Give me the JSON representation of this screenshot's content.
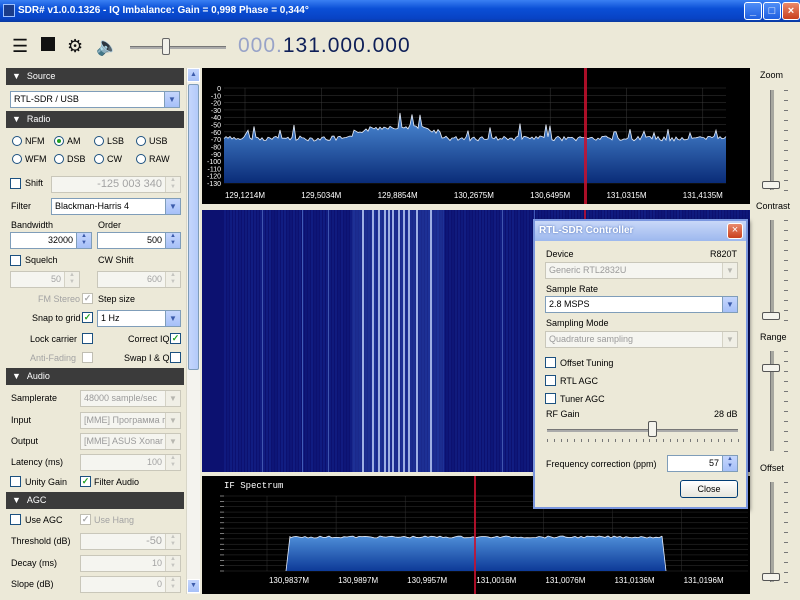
{
  "window": {
    "title": "SDR# v1.0.0.1326 - IQ Imbalance: Gain = 0,998 Phase = 0,344°"
  },
  "toolbar": {
    "frequency_dim": "000.",
    "frequency_main": "131.000.000",
    "volume": 0.38
  },
  "source": {
    "header": "Source",
    "device": "RTL-SDR / USB"
  },
  "radio": {
    "header": "Radio",
    "modes": [
      {
        "label": "NFM",
        "selected": false
      },
      {
        "label": "AM",
        "selected": true
      },
      {
        "label": "LSB",
        "selected": false
      },
      {
        "label": "USB",
        "selected": false
      },
      {
        "label": "WFM",
        "selected": false
      },
      {
        "label": "DSB",
        "selected": false
      },
      {
        "label": "CW",
        "selected": false
      },
      {
        "label": "RAW",
        "selected": false
      }
    ],
    "shift_label": "Shift",
    "shift_value": "-125 003 340",
    "filter_label": "Filter",
    "filter_value": "Blackman-Harris 4",
    "bandwidth_label": "Bandwidth",
    "bandwidth_value": "32000",
    "order_label": "Order",
    "order_value": "500",
    "squelch_label": "Squelch",
    "squelch_value": "50",
    "cwshift_label": "CW Shift",
    "cwshift_value": "600",
    "fmstereo_label": "FM Stereo",
    "stepsize_label": "Step size",
    "snap_label": "Snap to grid",
    "step_value": "1 Hz",
    "lockcarrier_label": "Lock carrier",
    "correctiq_label": "Correct IQ",
    "antifading_label": "Anti-Fading",
    "swapiq_label": "Swap I & Q"
  },
  "audio": {
    "header": "Audio",
    "samplerate_label": "Samplerate",
    "samplerate_value": "48000 sample/sec",
    "input_label": "Input",
    "input_value": "[MME] Программа пе",
    "output_label": "Output",
    "output_value": "[MME] ASUS Xonar D",
    "latency_label": "Latency (ms)",
    "latency_value": "100",
    "unity_label": "Unity Gain",
    "filteraudio_label": "Filter Audio"
  },
  "agc": {
    "header": "AGC",
    "useagc_label": "Use AGC",
    "usehang_label": "Use Hang",
    "threshold_label": "Threshold (dB)",
    "threshold_value": "-50",
    "decay_label": "Decay (ms)",
    "decay_value": "10",
    "slope_label": "Slope (dB)",
    "slope_value": "0"
  },
  "right_panel": {
    "zoom_label": "Zoom",
    "contrast_label": "Contrast",
    "range_label": "Range",
    "offset_label": "Offset"
  },
  "spectrum": {
    "y_ticks": [
      "0",
      "-10",
      "-20",
      "-30",
      "-40",
      "-50",
      "-60",
      "-70",
      "-80",
      "-90",
      "-100",
      "-110",
      "-120",
      "-130"
    ],
    "x_ticks": [
      "129,1214M",
      "129,5034M",
      "129,8854M",
      "130,2675M",
      "130,6495M",
      "131,0315M",
      "131,4135M"
    ]
  },
  "if_spectrum": {
    "title": "IF Spectrum",
    "x_ticks": [
      "130,9837M",
      "130,9897M",
      "130,9957M",
      "131,0016M",
      "131,0076M",
      "131,0136M",
      "131,0196M"
    ]
  },
  "dialog": {
    "title": "RTL-SDR Controller",
    "device_label": "Device",
    "device_tuner": "R820T",
    "device_value": "Generic RTL2832U",
    "samplerate_label": "Sample Rate",
    "samplerate_value": "2.8 MSPS",
    "samplingmode_label": "Sampling Mode",
    "samplingmode_value": "Quadrature sampling",
    "offset_label": "Offset Tuning",
    "rtlagc_label": "RTL AGC",
    "tuneragc_label": "Tuner AGC",
    "rfgain_label": "RF Gain",
    "rfgain_value": "28 dB",
    "rfgain_level": 0.55,
    "freqcorr_label": "Frequency correction (ppm)",
    "freqcorr_value": "57",
    "close_label": "Close"
  },
  "colors": {
    "accent": "#0e1f58",
    "section_header": "#3b3b3b",
    "marker": "#c8102e",
    "spectrum_fill": "#1c5fae"
  }
}
